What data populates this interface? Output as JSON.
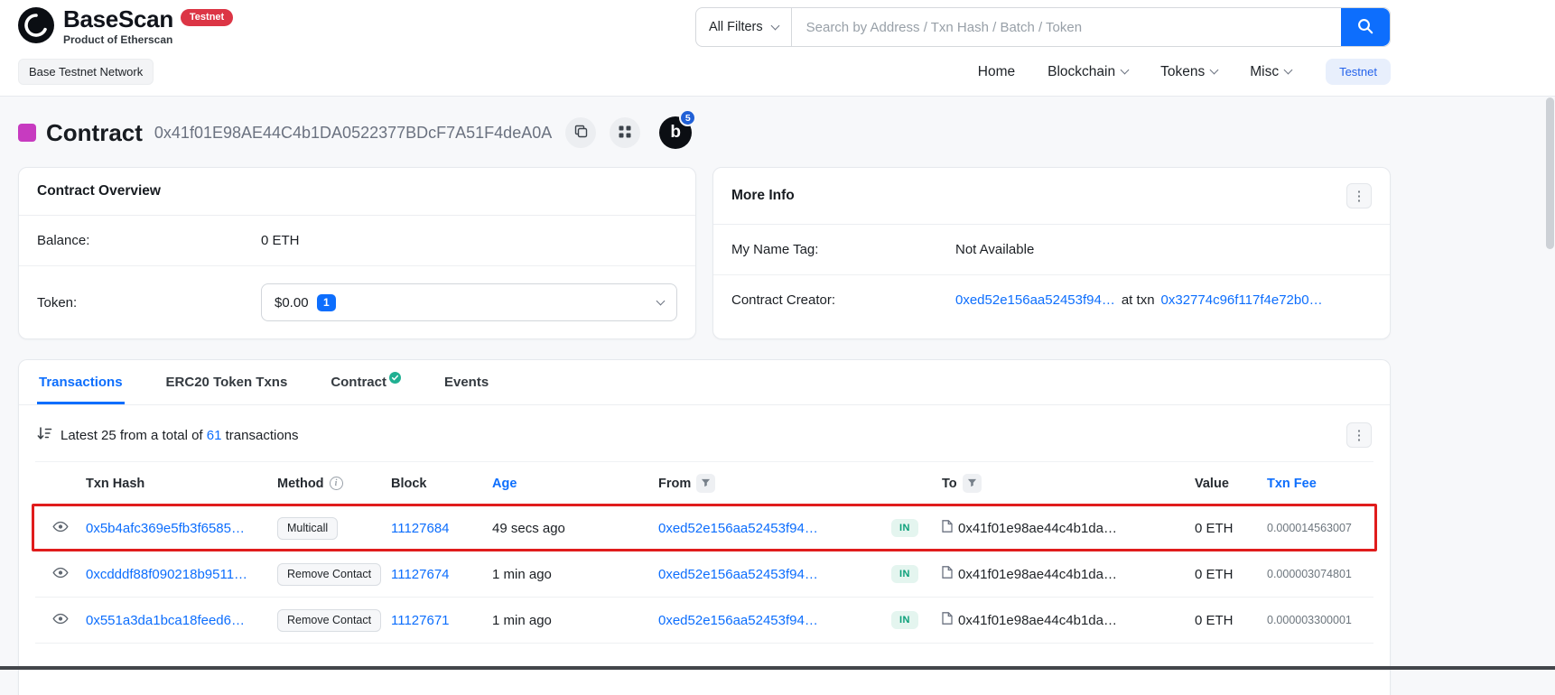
{
  "colors": {
    "accent": "#0d6efd",
    "link": "#0d6efd",
    "danger": "#dc3545",
    "success": "#00a186",
    "identicon": "#c73bc0",
    "highlight": "#e01c1c"
  },
  "header": {
    "brand_name": "BaseScan",
    "brand_badge": "Testnet",
    "brand_tagline": "Product of Etherscan",
    "network_label": "Base Testnet Network",
    "search": {
      "filter_label": "All Filters",
      "placeholder": "Search by Address / Txn Hash / Batch / Token"
    },
    "nav": [
      {
        "label": "Home"
      },
      {
        "label": "Blockchain"
      },
      {
        "label": "Tokens"
      },
      {
        "label": "Misc"
      }
    ],
    "testnet_button": "Testnet"
  },
  "page": {
    "title": "Contract",
    "address": "0x41f01E98AE44C4b1DA0522377BDcF7A51F4deA0A",
    "profile_letter": "b",
    "notification_count": "5"
  },
  "overview": {
    "title": "Contract Overview",
    "balance_label": "Balance:",
    "balance_value": "0 ETH",
    "token_label": "Token:",
    "token_value": "$0.00",
    "token_count": "1"
  },
  "more_info": {
    "title": "More Info",
    "name_tag_label": "My Name Tag:",
    "name_tag_value": "Not Available",
    "creator_label": "Contract Creator:",
    "creator_address": "0xed52e156aa52453f94…",
    "creator_connector": "at txn",
    "creator_txn": "0x32774c96f117f4e72b0…"
  },
  "tabs": [
    {
      "label": "Transactions"
    },
    {
      "label": "ERC20 Token Txns"
    },
    {
      "label": "Contract"
    },
    {
      "label": "Events"
    }
  ],
  "transactions": {
    "summary_prefix": "Latest 25 from a total of",
    "summary_count": "61",
    "summary_suffix": "transactions",
    "columns": {
      "hash": "Txn Hash",
      "method": "Method",
      "block": "Block",
      "age": "Age",
      "from": "From",
      "to": "To",
      "value": "Value",
      "fee": "Txn Fee"
    },
    "rows": [
      {
        "hash": "0x5b4afc369e5fb3f6585…",
        "method": "Multicall",
        "block": "11127684",
        "age": "49 secs ago",
        "from": "0xed52e156aa52453f94…",
        "direction": "IN",
        "to": "0x41f01e98ae44c4b1da…",
        "value": "0 ETH",
        "fee": "0.000014563007"
      },
      {
        "hash": "0xcdddf88f090218b9511…",
        "method": "Remove Contact",
        "block": "11127674",
        "age": "1 min ago",
        "from": "0xed52e156aa52453f94…",
        "direction": "IN",
        "to": "0x41f01e98ae44c4b1da…",
        "value": "0 ETH",
        "fee": "0.000003074801"
      },
      {
        "hash": "0x551a3da1bca18feed6…",
        "method": "Remove Contact",
        "block": "11127671",
        "age": "1 min ago",
        "from": "0xed52e156aa52453f94…",
        "direction": "IN",
        "to": "0x41f01e98ae44c4b1da…",
        "value": "0 ETH",
        "fee": "0.000003300001"
      }
    ]
  }
}
